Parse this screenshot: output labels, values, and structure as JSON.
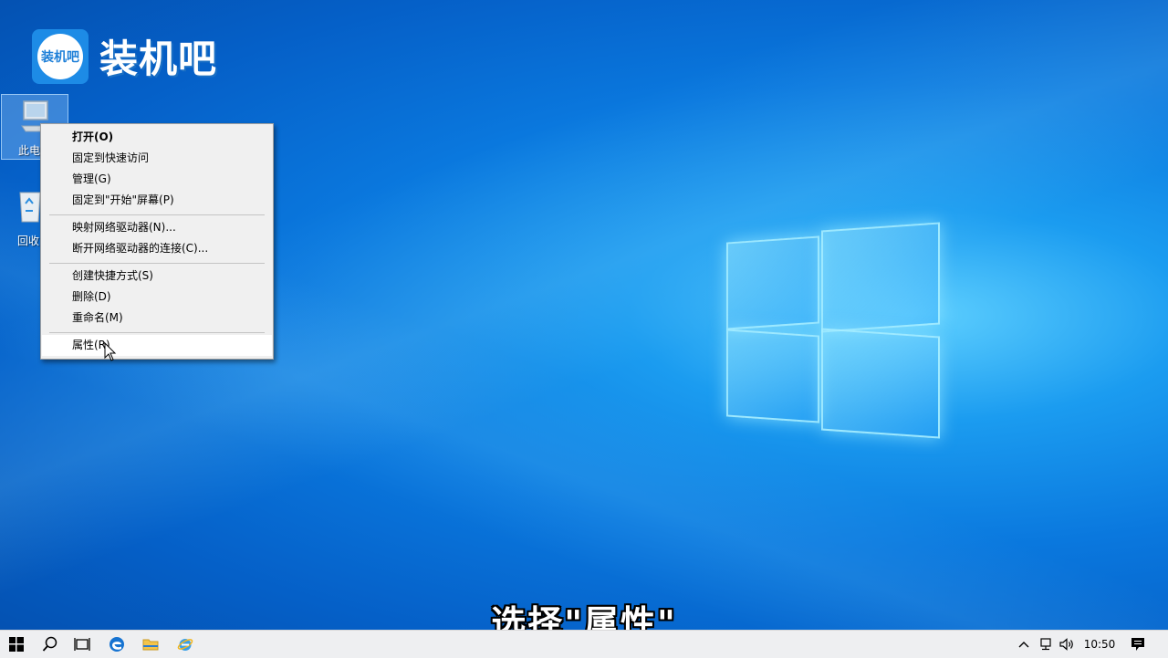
{
  "branding": {
    "badge_text": "装机吧",
    "title": "装机吧"
  },
  "desktop": {
    "icons": [
      {
        "label": "此电"
      },
      {
        "label": "回收"
      }
    ]
  },
  "context_menu": {
    "items": [
      {
        "label": "打开(O)"
      },
      {
        "label": "固定到快速访问"
      },
      {
        "label": "管理(G)"
      },
      {
        "label": "固定到\"开始\"屏幕(P)"
      },
      {
        "label": "映射网络驱动器(N)..."
      },
      {
        "label": "断开网络驱动器的连接(C)..."
      },
      {
        "label": "创建快捷方式(S)"
      },
      {
        "label": "删除(D)"
      },
      {
        "label": "重命名(M)"
      },
      {
        "label": "属性(R)"
      }
    ]
  },
  "subtitle": "选择\"属性\"",
  "taskbar": {
    "icons": [
      "windows-start-icon",
      "search-icon",
      "task-view-icon",
      "edge-icon",
      "file-explorer-icon",
      "internet-explorer-icon"
    ],
    "tray": {
      "chevron": "^",
      "clock": "10:50"
    }
  },
  "colors": {
    "accent": "#1d8be6",
    "desktop_blue": "#0a78de",
    "menu_bg": "#f0f0f0"
  }
}
